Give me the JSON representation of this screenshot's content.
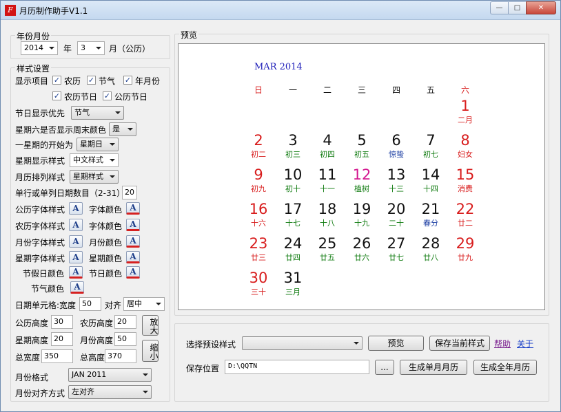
{
  "window": {
    "title": "月历制作助手V1.1"
  },
  "year_month": {
    "group_label": "年份月份",
    "year": "2014",
    "year_suffix": "年",
    "month": "3",
    "month_suffix": "月（公历）"
  },
  "style": {
    "group_label": "样式设置",
    "display_items_label": "显示项目",
    "checkboxes": {
      "lunar": {
        "label": "农历",
        "checked": "✓"
      },
      "solar_term": {
        "label": "节气",
        "checked": "✓"
      },
      "year_month": {
        "label": "年月份",
        "checked": "✓"
      },
      "lunar_festival": {
        "label": "农历节日",
        "checked": "✓"
      },
      "solar_festival": {
        "label": "公历节日",
        "checked": "✓"
      }
    },
    "holiday_priority_label": "节日显示优先",
    "holiday_priority": "节气",
    "saturday_weekend_label": "星期六是否显示周末颜色",
    "saturday_weekend": "是",
    "week_start_label": "一星期的开始为",
    "week_start": "星期日",
    "week_display_label": "星期显示样式",
    "week_display": "中文样式",
    "month_layout_label": "月历排列样式",
    "month_layout": "星期样式",
    "per_line_label": "单行或单列日期数目（2-31）",
    "per_line": "20",
    "solar_font_label": "公历字体样式",
    "solar_color_label": "字体颜色",
    "lunar_font_label": "农历字体样式",
    "lunar_color_label": "字体颜色",
    "month_font_label": "月份字体样式",
    "month_color_label": "月份颜色",
    "week_font_label": "星期字体样式",
    "week_color_label": "星期颜色",
    "holiday_color_label": "节假日颜色",
    "festival_color_label": "节日颜色",
    "solar_term_color_label": "节气颜色",
    "cell_width_label": "日期单元格:宽度",
    "cell_width": "50",
    "align_label": "对齐",
    "align": "居中",
    "solar_height_label": "公历高度",
    "solar_height": "30",
    "lunar_height_label": "农历高度",
    "lunar_height": "20",
    "week_height_label": "星期高度",
    "week_height": "20",
    "month_height_label": "月份高度",
    "month_height": "50",
    "total_width_label": "总宽度",
    "total_width": "350",
    "total_height_label": "总高度",
    "total_height": "370",
    "zoom_in": "放大",
    "zoom_out": "缩小",
    "month_format_label": "月份格式",
    "month_format": "JAN 2011",
    "month_align_label": "月份对齐方式",
    "month_align": "左对齐"
  },
  "preview": {
    "group_label": "预览",
    "month_title": "MAR 2014",
    "weekdays": [
      "日",
      "一",
      "二",
      "三",
      "四",
      "五",
      "六"
    ],
    "days": [
      {
        "d": "1",
        "s": "二月",
        "dc": "red",
        "sc": "red"
      },
      {
        "d": "2",
        "s": "初二",
        "dc": "red",
        "sc": "red"
      },
      {
        "d": "3",
        "s": "初三",
        "dc": "black",
        "sc": "green"
      },
      {
        "d": "4",
        "s": "初四",
        "dc": "black",
        "sc": "green"
      },
      {
        "d": "5",
        "s": "初五",
        "dc": "black",
        "sc": "green"
      },
      {
        "d": "6",
        "s": "惊蛰",
        "dc": "black",
        "sc": "blue"
      },
      {
        "d": "7",
        "s": "初七",
        "dc": "black",
        "sc": "green"
      },
      {
        "d": "8",
        "s": "妇女",
        "dc": "red",
        "sc": "red"
      },
      {
        "d": "9",
        "s": "初九",
        "dc": "red",
        "sc": "red"
      },
      {
        "d": "10",
        "s": "初十",
        "dc": "black",
        "sc": "green"
      },
      {
        "d": "11",
        "s": "十一",
        "dc": "black",
        "sc": "green"
      },
      {
        "d": "12",
        "s": "植树",
        "dc": "magenta",
        "sc": "green"
      },
      {
        "d": "13",
        "s": "十三",
        "dc": "black",
        "sc": "green"
      },
      {
        "d": "14",
        "s": "十四",
        "dc": "black",
        "sc": "green"
      },
      {
        "d": "15",
        "s": "消费",
        "dc": "red",
        "sc": "red"
      },
      {
        "d": "16",
        "s": "十六",
        "dc": "red",
        "sc": "red"
      },
      {
        "d": "17",
        "s": "十七",
        "dc": "black",
        "sc": "green"
      },
      {
        "d": "18",
        "s": "十八",
        "dc": "black",
        "sc": "green"
      },
      {
        "d": "19",
        "s": "十九",
        "dc": "black",
        "sc": "green"
      },
      {
        "d": "20",
        "s": "二十",
        "dc": "black",
        "sc": "green"
      },
      {
        "d": "21",
        "s": "春分",
        "dc": "black",
        "sc": "blue"
      },
      {
        "d": "22",
        "s": "廿二",
        "dc": "red",
        "sc": "red"
      },
      {
        "d": "23",
        "s": "廿三",
        "dc": "red",
        "sc": "red"
      },
      {
        "d": "24",
        "s": "廿四",
        "dc": "black",
        "sc": "green"
      },
      {
        "d": "25",
        "s": "廿五",
        "dc": "black",
        "sc": "green"
      },
      {
        "d": "26",
        "s": "廿六",
        "dc": "black",
        "sc": "green"
      },
      {
        "d": "27",
        "s": "廿七",
        "dc": "black",
        "sc": "green"
      },
      {
        "d": "28",
        "s": "廿八",
        "dc": "black",
        "sc": "green"
      },
      {
        "d": "29",
        "s": "廿九",
        "dc": "red",
        "sc": "red"
      },
      {
        "d": "30",
        "s": "三十",
        "dc": "red",
        "sc": "red"
      },
      {
        "d": "31",
        "s": "三月",
        "dc": "black",
        "sc": "green"
      }
    ],
    "first_weekday_index": 6
  },
  "bottom": {
    "preset_label": "选择预设样式",
    "preset_value": "",
    "preview_button": "预览",
    "save_style_button": "保存当前样式",
    "help_link": "帮助",
    "about_link": "关于",
    "save_path_label": "保存位置",
    "save_path": "D:\\QQTN",
    "browse_button": "...",
    "gen_month_button": "生成单月月历",
    "gen_year_button": "生成全年月历"
  },
  "colors": {
    "red": "#d81c1c",
    "black": "#111111",
    "green": "#0e7a0e",
    "blue": "#1d3fa3",
    "magenta": "#d3168f",
    "link_purple": "#7a1f8f",
    "link_blue": "#1a3fc8"
  }
}
